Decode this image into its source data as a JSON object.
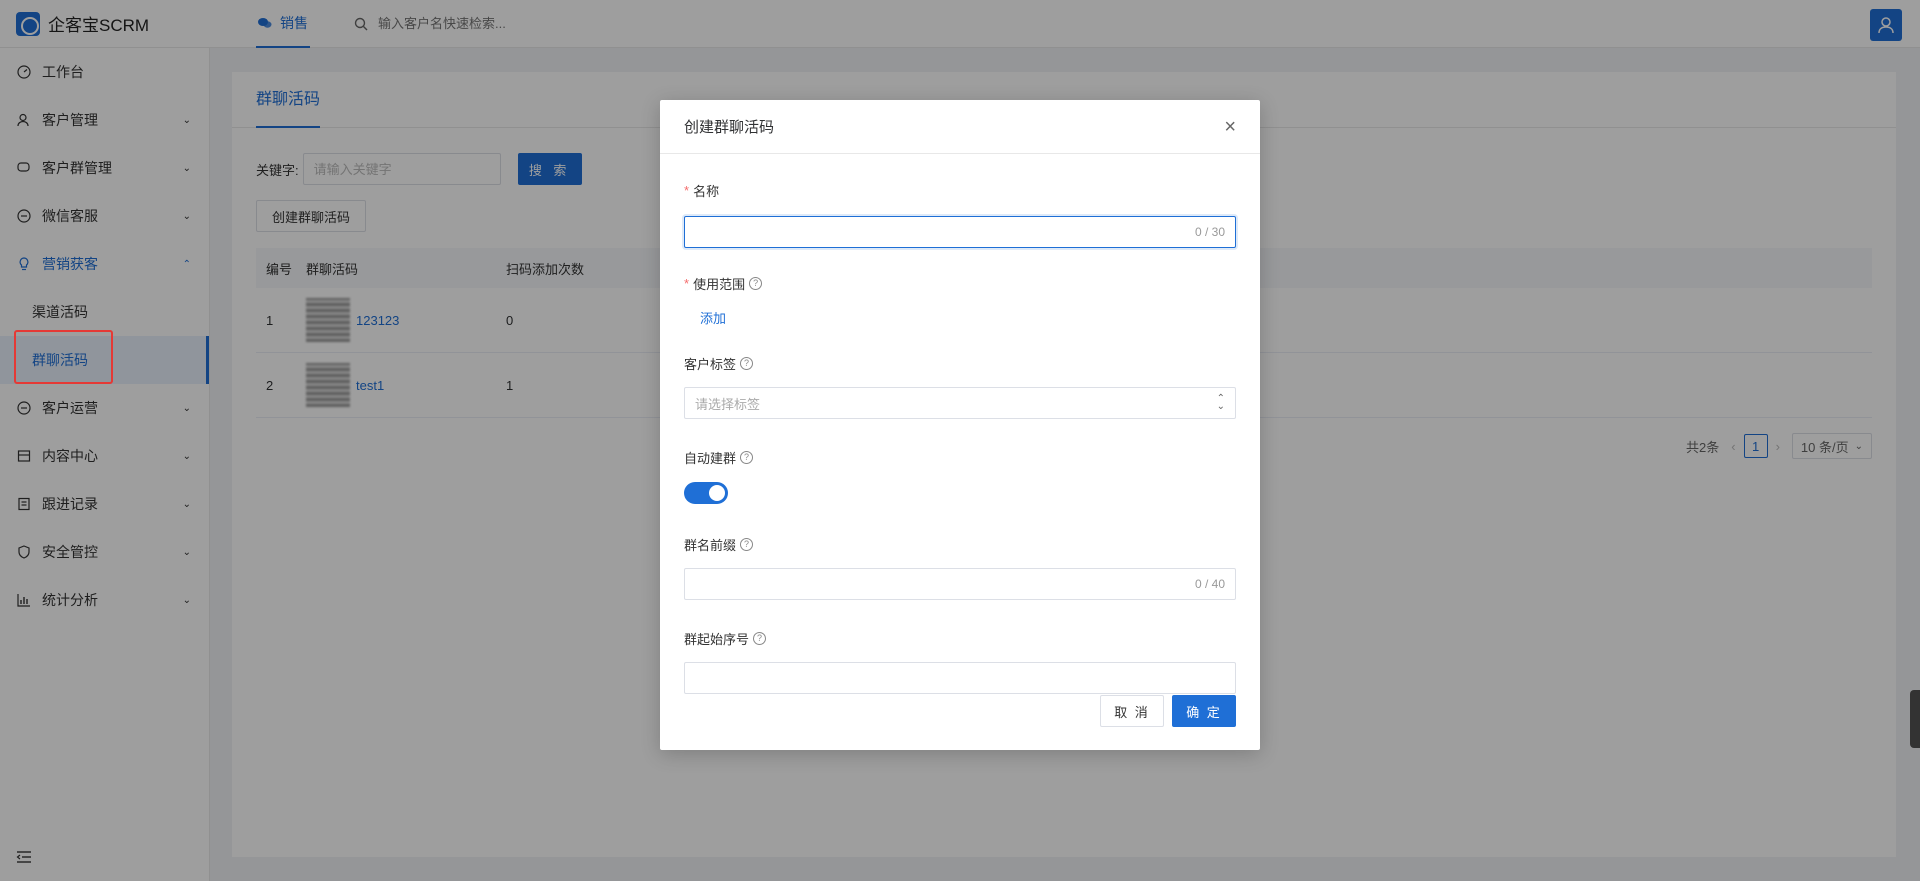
{
  "app": {
    "title": "企客宝SCRM"
  },
  "topbar": {
    "tab_label": "销售",
    "search_placeholder": "输入客户名快速检索..."
  },
  "sidebar": {
    "items": [
      {
        "label": "工作台",
        "icon": "dashboard-icon",
        "expandable": false
      },
      {
        "label": "客户管理",
        "icon": "user-icon",
        "expandable": true
      },
      {
        "label": "客户群管理",
        "icon": "chat-icon",
        "expandable": true
      },
      {
        "label": "微信客服",
        "icon": "message-icon",
        "expandable": true
      },
      {
        "label": "营销获客",
        "icon": "bulb-icon",
        "expandable": true,
        "expanded": true
      },
      {
        "label": "客户运营",
        "icon": "message-icon",
        "expandable": true
      },
      {
        "label": "内容中心",
        "icon": "store-icon",
        "expandable": true
      },
      {
        "label": "跟进记录",
        "icon": "record-icon",
        "expandable": true
      },
      {
        "label": "安全管控",
        "icon": "shield-icon",
        "expandable": true
      },
      {
        "label": "统计分析",
        "icon": "chart-icon",
        "expandable": true
      }
    ],
    "sub_items": [
      {
        "label": "渠道活码"
      },
      {
        "label": "群聊活码",
        "selected": true
      }
    ]
  },
  "page": {
    "tab": "群聊活码",
    "filter_label": "关键字:",
    "filter_placeholder": "请输入关键字",
    "search_button": "搜 索",
    "create_button": "创建群聊活码",
    "table": {
      "headers": [
        "编号",
        "群聊活码",
        "扫码添加次数"
      ],
      "rows": [
        {
          "no": "1",
          "name": "123123",
          "count": "0"
        },
        {
          "no": "2",
          "name": "test1",
          "count": "1"
        }
      ]
    },
    "pager": {
      "total": "共2条",
      "current": "1",
      "page_size": "10 条/页"
    }
  },
  "modal": {
    "title": "创建群聊活码",
    "fields": {
      "name_label": "名称",
      "name_counter": "0 / 30",
      "scope_label": "使用范围",
      "scope_add": "添加",
      "tag_label": "客户标签",
      "tag_placeholder": "请选择标签",
      "auto_label": "自动建群",
      "auto_on": true,
      "prefix_label": "群名前缀",
      "prefix_counter": "0 / 40",
      "start_label": "群起始序号"
    },
    "cancel": "取 消",
    "ok": "确 定"
  },
  "colors": {
    "primary": "#1f6fd6",
    "required": "#f56c6c",
    "highlight": "#e53935"
  }
}
